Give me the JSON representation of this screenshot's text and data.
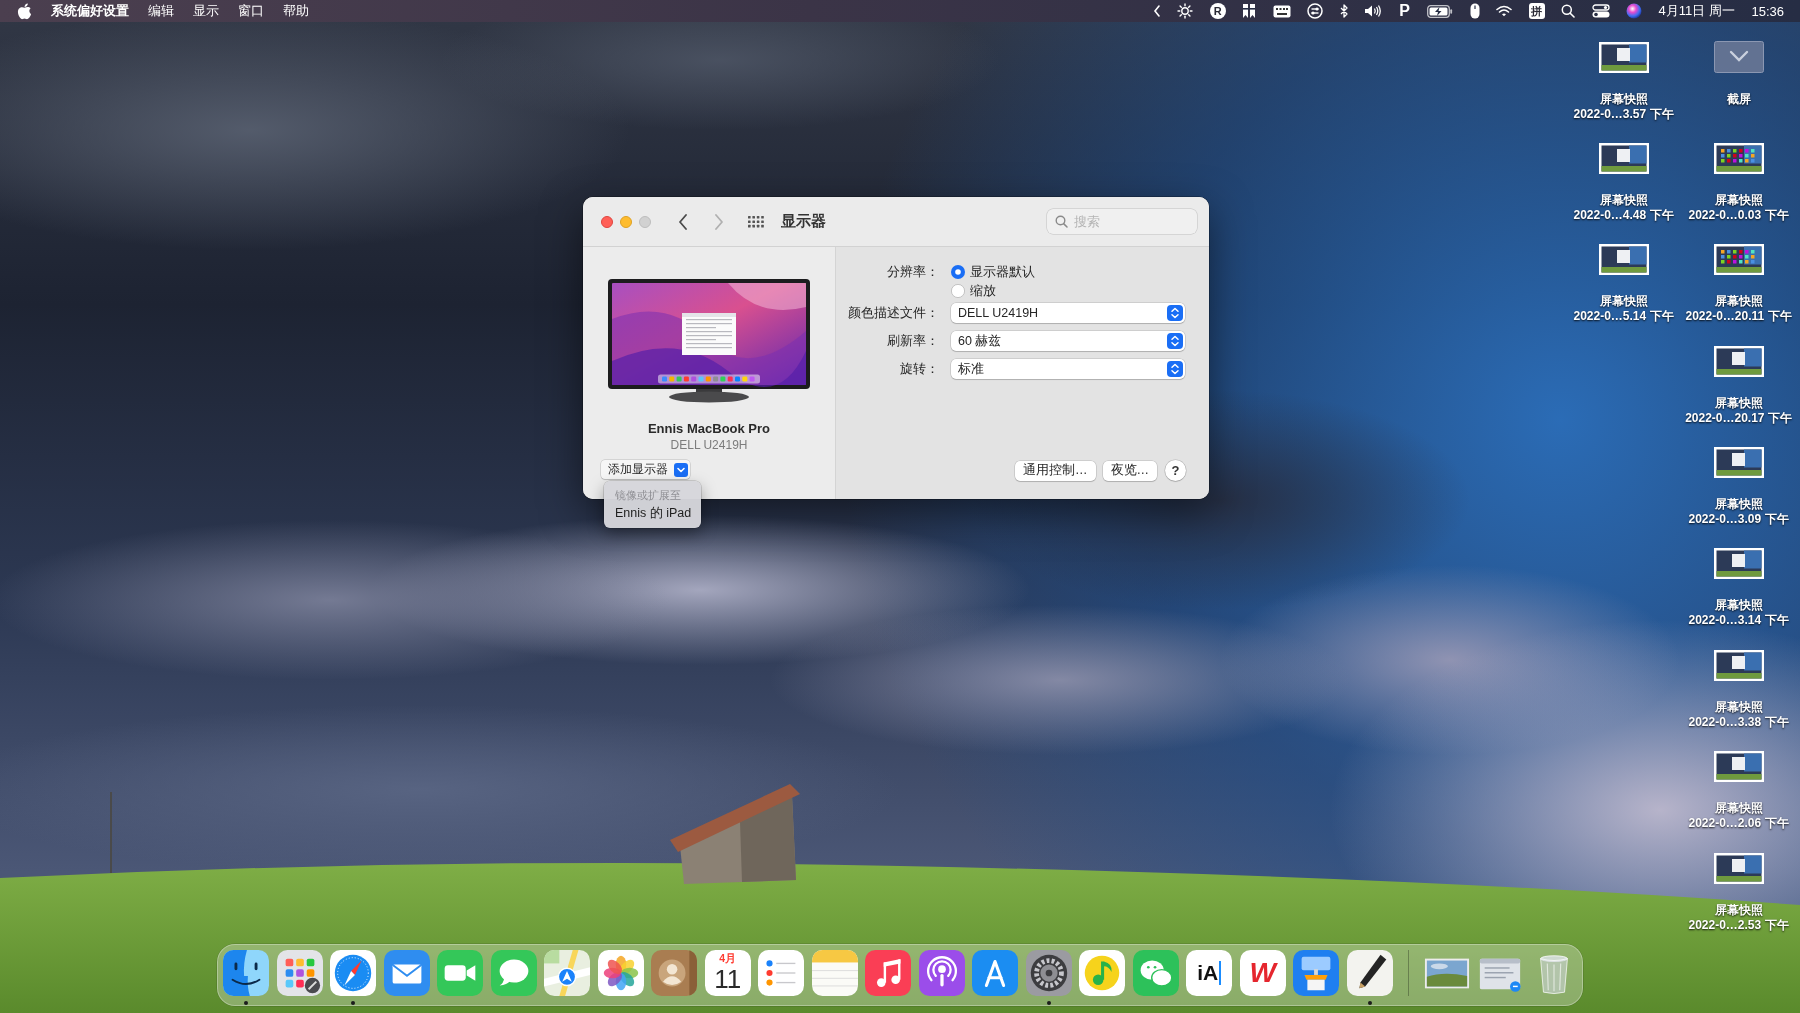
{
  "menu_bar": {
    "app_name": "系统偏好设置",
    "menus": [
      "编辑",
      "显示",
      "窗口",
      "帮助"
    ],
    "status_items": [
      {
        "kind": "chevron"
      },
      {
        "kind": "brightness"
      },
      {
        "kind": "badge",
        "text": "R"
      },
      {
        "kind": "bookmarks"
      },
      {
        "kind": "keyboard"
      },
      {
        "kind": "toggles"
      },
      {
        "kind": "bluetooth"
      },
      {
        "kind": "volume"
      },
      {
        "kind": "glyph",
        "text": "P"
      },
      {
        "kind": "battery"
      },
      {
        "kind": "mouse"
      },
      {
        "kind": "wifi"
      },
      {
        "kind": "input",
        "text": "拼"
      },
      {
        "kind": "search"
      },
      {
        "kind": "control"
      },
      {
        "kind": "siri"
      }
    ],
    "date": "4月11日 周一",
    "time": "15:36"
  },
  "window": {
    "title": "显示器",
    "controls": [
      {
        "kind": "close",
        "disabled": false
      },
      {
        "kind": "minimize",
        "disabled": false
      },
      {
        "kind": "zoom",
        "disabled": true
      }
    ],
    "navigation": [
      {
        "kind": "back",
        "disabled": false
      },
      {
        "kind": "forward",
        "disabled": true
      }
    ],
    "search": {
      "placeholder": "搜索"
    },
    "display": {
      "name": "Ennis MacBook Pro",
      "model": "DELL U2419H"
    },
    "add_display": {
      "label": "添加显示器",
      "menu": {
        "header": "镜像或扩展至",
        "items": [
          {
            "label": "Ennis 的 iPad"
          }
        ]
      }
    },
    "resolution": {
      "label": "分辨率：",
      "options": [
        {
          "label": "显示器默认",
          "selected": true
        },
        {
          "label": "缩放",
          "selected": false
        }
      ]
    },
    "popups": [
      {
        "label": "颜色描述文件：",
        "value": "DELL U2419H"
      },
      {
        "label": "刷新率：",
        "value": "60 赫兹"
      },
      {
        "label": "旋转：",
        "value": "标准"
      }
    ],
    "buttons": [
      {
        "label": "通用控制…"
      },
      {
        "label": "夜览…"
      }
    ],
    "help": {
      "label": "?"
    }
  },
  "desktop": {
    "columns": [
      [
        {
          "kind": "window",
          "name": "屏幕快照",
          "date": "2022-0…3.57 下午"
        },
        {
          "kind": "window",
          "name": "屏幕快照",
          "date": "2022-0…4.48 下午"
        },
        {
          "kind": "window",
          "name": "屏幕快照",
          "date": "2022-0…5.14 下午"
        }
      ],
      [
        {
          "kind": "folder",
          "name": "截屏"
        },
        {
          "kind": "grid",
          "name": "屏幕快照",
          "date": "2022-0…0.03 下午"
        },
        {
          "kind": "grid",
          "name": "屏幕快照",
          "date": "2022-0…20.11 下午"
        },
        {
          "kind": "window",
          "name": "屏幕快照",
          "date": "2022-0…20.17 下午"
        },
        {
          "kind": "window",
          "name": "屏幕快照",
          "date": "2022-0…3.09 下午"
        },
        {
          "kind": "window",
          "name": "屏幕快照",
          "date": "2022-0…3.14 下午"
        },
        {
          "kind": "window",
          "name": "屏幕快照",
          "date": "2022-0…3.38 下午"
        },
        {
          "kind": "window",
          "name": "屏幕快照",
          "date": "2022-0…2.06 下午"
        },
        {
          "kind": "window",
          "name": "屏幕快照",
          "date": "2022-0…2.53 下午"
        }
      ]
    ]
  },
  "dock": {
    "apps": [
      {
        "kind": "face",
        "running": true
      },
      {
        "kind": "launcher",
        "running": false
      },
      {
        "kind": "compass",
        "running": true
      },
      {
        "kind": "envelope",
        "running": false
      },
      {
        "kind": "camera",
        "running": false
      },
      {
        "kind": "bubble",
        "running": false
      },
      {
        "kind": "map",
        "running": false
      },
      {
        "kind": "flower",
        "running": false
      },
      {
        "kind": "contact",
        "running": false
      },
      {
        "kind": "calendar",
        "month": "4月",
        "day": "11",
        "running": false
      },
      {
        "kind": "checklist",
        "running": false
      },
      {
        "kind": "notes",
        "running": false
      },
      {
        "kind": "music",
        "running": false
      },
      {
        "kind": "podcast",
        "running": false
      },
      {
        "kind": "store",
        "running": false
      },
      {
        "kind": "gear",
        "running": true
      },
      {
        "kind": "disc",
        "running": false
      },
      {
        "kind": "chat",
        "running": false
      },
      {
        "kind": "writer",
        "text": "iA",
        "running": false
      },
      {
        "kind": "office",
        "text": "W",
        "running": false
      },
      {
        "kind": "podium",
        "running": false
      },
      {
        "kind": "pen",
        "running": true
      }
    ],
    "others": [
      {
        "kind": "photo"
      },
      {
        "kind": "document"
      },
      {
        "kind": "trash"
      }
    ]
  }
}
